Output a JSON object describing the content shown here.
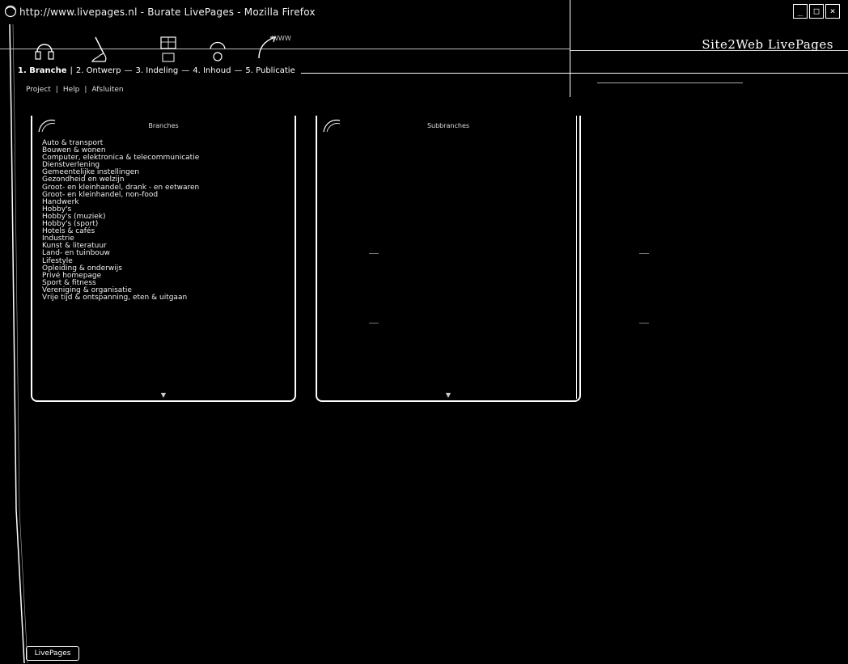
{
  "window": {
    "title": "http://www.livepages.nl - Burate LivePages - Mozilla Firefox",
    "controls": [
      "_",
      "□",
      "×"
    ]
  },
  "brand": {
    "name": "Site2Web LivePages"
  },
  "wizard": {
    "steps": [
      {
        "label": "1. Branche",
        "icon": "headphones-icon"
      },
      {
        "label": "2. Ontwerp",
        "icon": "brush-icon"
      },
      {
        "label": "3. Indeling",
        "icon": "layout-icon"
      },
      {
        "label": "4. Inhoud",
        "icon": "content-icon"
      },
      {
        "label": "5. Publicatie",
        "icon": "publish-icon"
      }
    ],
    "active_index": 0,
    "publish_sub": "WWW"
  },
  "subnav": {
    "items": [
      "Project",
      "Help",
      "Afsluiten"
    ]
  },
  "panels": {
    "left": {
      "title": "Branches",
      "items": [
        "Auto & transport",
        "Bouwen & wonen",
        "Computer, elektronica & telecommunicatie",
        "Dienstverlening",
        "Gemeentelijke instellingen",
        "Gezondheid en welzijn",
        "Groot- en kleinhandel, drank - en eetwaren",
        "Groot- en kleinhandel, non-food",
        "Handwerk",
        "Hobby's",
        "Hobby's (muziek)",
        "Hobby's (sport)",
        "Hotels & cafés",
        "Industrie",
        "Kunst & literatuur",
        "Land- en tuinbouw",
        "Lifestyle",
        "Opleiding & onderwijs",
        "Privé homepage",
        "Sport & fitness",
        "Vereniging & organisatie",
        "Vrije tijd & ontspanning, eten & uitgaan"
      ],
      "footer": "▼"
    },
    "middle": {
      "title": "Subbranches",
      "footer": "▼"
    }
  },
  "bottom": {
    "label": "LivePages"
  }
}
